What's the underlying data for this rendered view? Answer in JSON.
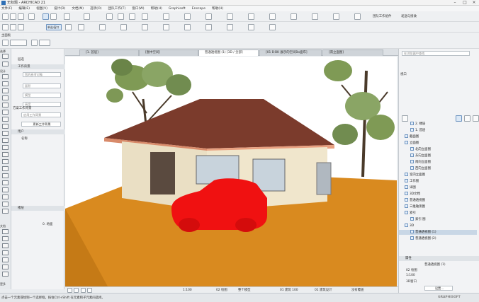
{
  "app": {
    "title": "无标题 - ARCHICAD 21"
  },
  "menu": [
    "文件(F)",
    "编辑(E)",
    "视图(V)",
    "设计(D)",
    "文档(M)",
    "选项(O)",
    "团队工作(T)",
    "窗口(W)",
    "帮助(H)",
    "Graphisoft",
    "Enscape",
    "帮助(H)"
  ],
  "toolbar1": {
    "teamwork": "团队工作组件",
    "send_receive": "发送与接收"
  },
  "toolbar2": {
    "select": "单选/窗口"
  },
  "left": {
    "main_label": "主面板",
    "toolbox_labels": [
      "选择",
      "设计",
      "文档",
      "更多"
    ],
    "info": {
      "header": "层选",
      "section1": "工作背景",
      "field_placeholder": "您的参考对象",
      "field2": "面积",
      "field3": "模型",
      "field4": "高度",
      "wall_label": "方案工作背景",
      "switch_btn": "启用工作背景",
      "apply_btn": "更新工作背景",
      "user_header": "用户",
      "user_value": "名称",
      "floor_header": "楼层",
      "floor_value": "0. 地面"
    }
  },
  "tabs": [
    {
      "label": "[1. 首层]",
      "active": false
    },
    {
      "label": "[图中空间]",
      "active": false
    },
    {
      "label": "普通透视图 (1) [3D / 全部]",
      "active": true
    },
    {
      "label": "[01 B-BK 展示的空间Bo面布]",
      "active": false
    },
    {
      "label": "[南立面图]",
      "active": false
    }
  ],
  "status": {
    "undo": "",
    "scale": "1:100",
    "story": "02 绘图",
    "model": "整个模型",
    "view": "01 建筑 100",
    "design": "01 建筑设计",
    "renovation": "没有覆盖"
  },
  "hint_text": "点击一个元素或绘制一个选择框。按住Ctrl+Shift 在元素和子元素间选择。",
  "brand": "GRAPHISOFT",
  "right": {
    "search_placeholder": "在浏览器中查找",
    "section_label": "视口",
    "tree": [
      "2. 楼层",
      "1. 首层",
      "截面图",
      "立面图",
      "北向立面图",
      "东向立面图",
      "南向立面图",
      "西向立面图",
      "室内立面图",
      "工作图",
      "详图",
      "3D文档",
      "普通透视图",
      "三维轴测图",
      "索引",
      "索引 图",
      "3D",
      "普通透视图 (1)",
      "普通透视图 (2)"
    ],
    "props_header": "属性",
    "props_items": [
      "普通透视图 (1)",
      "02 绘图",
      "1:100",
      "3D窗口"
    ],
    "settings_btn": "设置..."
  }
}
